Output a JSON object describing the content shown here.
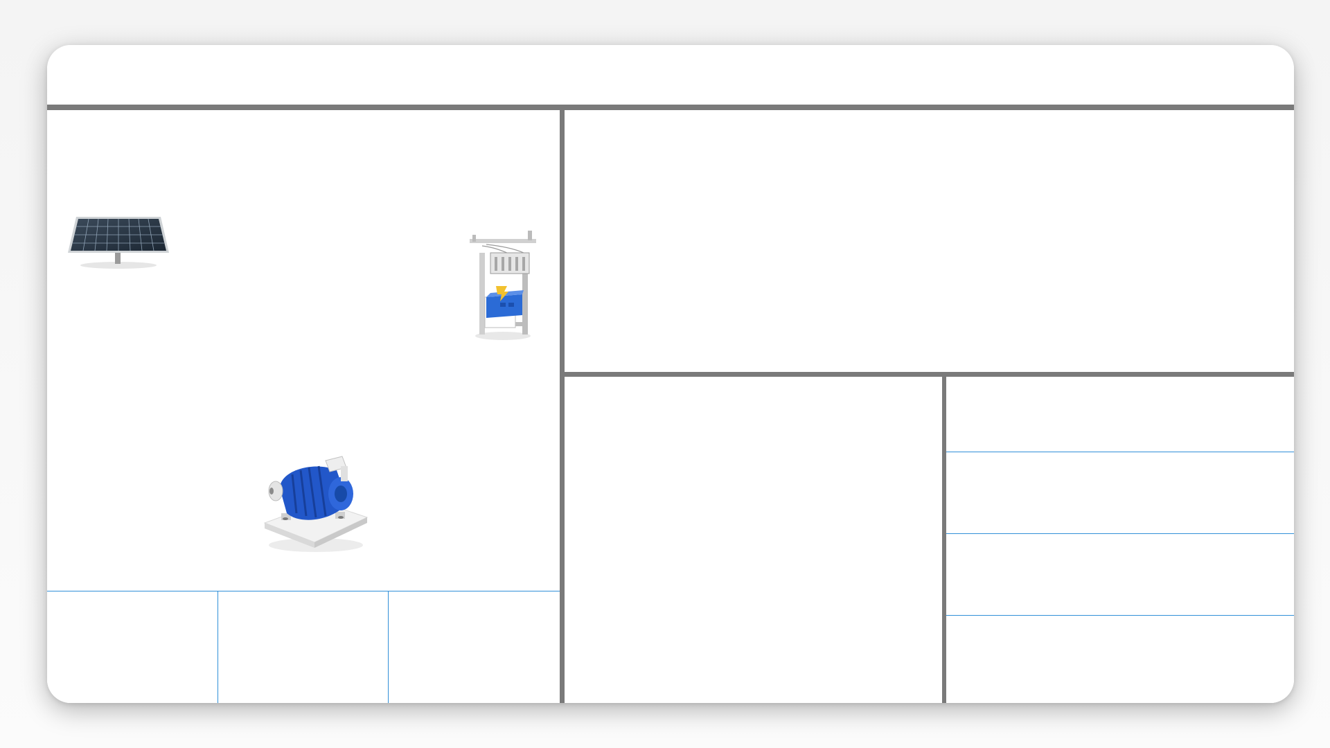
{
  "header": {
    "title": ""
  },
  "diagram": {
    "devices": [
      {
        "name": "solar-panel",
        "label": ""
      },
      {
        "name": "transformer-pole",
        "label": ""
      },
      {
        "name": "water-pump",
        "label": ""
      }
    ],
    "stats": [
      "",
      "",
      ""
    ]
  },
  "chart_panel": {
    "title": ""
  },
  "detail_panel": {
    "title": ""
  },
  "list_panel": {
    "rows": [
      "",
      "",
      "",
      ""
    ]
  },
  "colors": {
    "divider": "#7a7a7a",
    "accent_line": "#2f8fd8",
    "pump_blue": "#1f5fcf"
  }
}
